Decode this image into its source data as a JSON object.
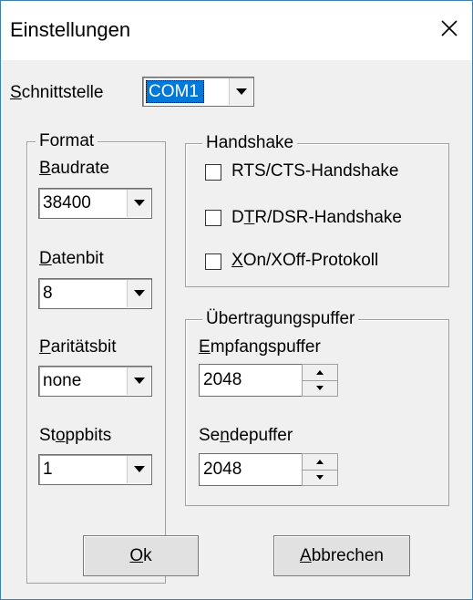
{
  "window": {
    "title": "Einstellungen",
    "close_glyph": "✕"
  },
  "interface": {
    "label_u": "S",
    "label_rest": "chnittstelle",
    "value": "COM1"
  },
  "format": {
    "title": "Format",
    "baudrate": {
      "label_u": "B",
      "label_rest": "audrate",
      "value": "38400"
    },
    "datenbit": {
      "label_u": "D",
      "label_rest": "atenbit",
      "value": "8"
    },
    "paritaet": {
      "label_u": "P",
      "label_rest": "aritätsbit",
      "value": "none"
    },
    "stoppbits": {
      "label_pre": "St",
      "label_u": "o",
      "label_rest": "ppbits",
      "value": "1"
    }
  },
  "handshake": {
    "title": "Handshake",
    "rts": {
      "label": "RTS/CTS-Handshake",
      "checked": false
    },
    "dtr": {
      "label_pre": "D",
      "label_u": "T",
      "label_rest": "R/DSR-Handshake",
      "checked": false
    },
    "xon": {
      "label_u": "X",
      "label_rest": "On/XOff-Protokoll",
      "checked": false
    }
  },
  "buffer": {
    "title": "Übertragungspuffer",
    "empfang": {
      "label_u": "E",
      "label_rest": "mpfangspuffer",
      "value": "2048"
    },
    "sende": {
      "label_pre": "Se",
      "label_u": "n",
      "label_rest": "depuffer",
      "value": "2048"
    }
  },
  "buttons": {
    "ok": {
      "label_u": "O",
      "label_rest": "k"
    },
    "cancel": {
      "label_u": "A",
      "label_rest": "bbrechen"
    }
  }
}
